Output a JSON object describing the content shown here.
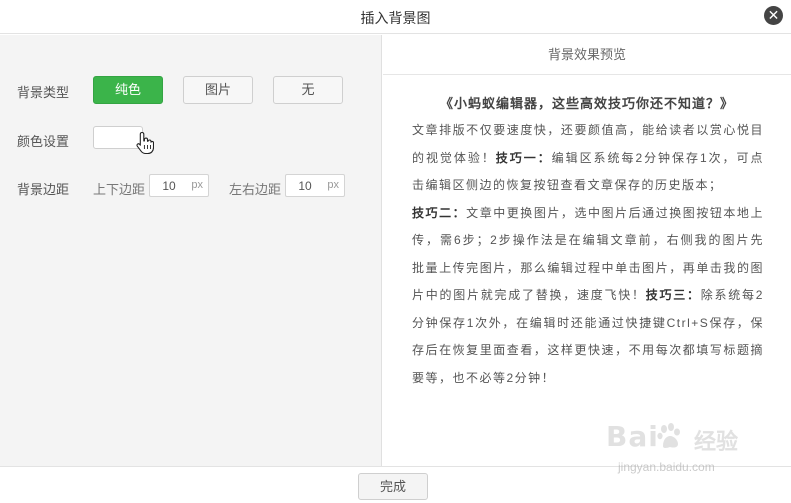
{
  "dialog": {
    "title": "插入背景图",
    "close_glyph": "✕"
  },
  "settings": {
    "type_label": "背景类型",
    "type_options": [
      "纯色",
      "图片",
      "无"
    ],
    "type_selected": "纯色",
    "color_label": "颜色设置",
    "color_value": "#ffffff",
    "margin_label": "背景边距",
    "vertical_margin_label": "上下边距",
    "vertical_margin_value": "10",
    "horizontal_margin_label": "左右边距",
    "horizontal_margin_value": "10",
    "unit": "px"
  },
  "preview": {
    "heading": "背景效果预览",
    "article_title": "《小蚂蚁编辑器，这些高效技巧你还不知道？》",
    "p1": "文章排版不仅要速度快，还要颜值高，能给读者以赏心悦目的视觉体验！",
    "tip1_label": "技巧一：",
    "tip1_text": "编辑区系统每2分钟保存1次，可点击编辑区侧边的恢复按钮查看文章保存的历史版本；",
    "tip2_label": "技巧二：",
    "tip2_text": "文章中更换图片，选中图片后通过换图按钮本地上传，需6步；2步操作法是在编辑文章前，右侧我的图片先批量上传完图片，那么编辑过程中单击图片，再单击我的图片中的图片就完成了替换，速度飞快！",
    "tip3_label": "技巧三：",
    "tip3_text": "除系统每2分钟保存1次外，在编辑时还能通过快捷键Ctrl+S保存，保存后在恢复里面查看，这样更快速，不用每次都填写标题摘要等，也不必等2分钟！"
  },
  "footer": {
    "done_label": "完成"
  },
  "watermark": {
    "brand": "Bai",
    "brand2": "经验",
    "url": "jingyan.baidu.com"
  },
  "colors": {
    "accent": "#3bb44a",
    "left_bg": "#f4f4f4"
  }
}
